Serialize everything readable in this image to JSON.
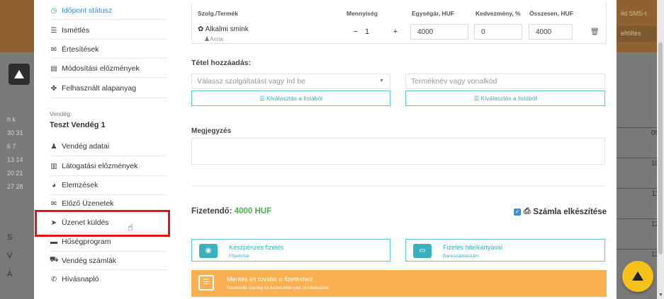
{
  "background": {
    "right_top_text": "ild SMS-t",
    "right_button": "eltöltés",
    "calendar_lines": [
      "h  k",
      "30  31",
      "6  7",
      "13  14",
      "20  21",
      "27  28"
    ],
    "lower_letters": [
      "S",
      "V",
      "Á"
    ],
    "times": [
      "09",
      "10",
      "11",
      "12",
      "13"
    ]
  },
  "sidebar": {
    "items_top": [
      {
        "icon": "clock-icon",
        "glyph": "◷",
        "label": "Időpont státusz",
        "active": true
      },
      {
        "icon": "list-icon",
        "glyph": "☰",
        "label": "Ismétlés"
      },
      {
        "icon": "chat-icon",
        "glyph": "✉",
        "label": "Értesítések"
      },
      {
        "icon": "file-icon",
        "glyph": "▤",
        "label": "Módosítási előzmények"
      },
      {
        "icon": "cubes-icon",
        "glyph": "✤",
        "label": "Felhasznált alapanyag"
      }
    ],
    "guest_label": "Vendég:",
    "guest_name": "Teszt Vendég 1",
    "items_bottom": [
      {
        "icon": "user-icon",
        "glyph": "♟",
        "label": "Vendég adatai"
      },
      {
        "icon": "history-icon",
        "glyph": "▥",
        "label": "Látogatási előzmények"
      },
      {
        "icon": "pie-icon",
        "glyph": "◕",
        "label": "Elemzések"
      },
      {
        "icon": "envelope-icon",
        "glyph": "✉",
        "label": "Előző Üzenetek"
      },
      {
        "icon": "send-icon",
        "glyph": "➤",
        "label": "Üzenet küldés"
      },
      {
        "icon": "card-icon",
        "glyph": "▬",
        "label": "Hűségprogram"
      },
      {
        "icon": "car-icon",
        "glyph": "⛟",
        "label": "Vendég számlák"
      },
      {
        "icon": "phone-icon",
        "glyph": "✆",
        "label": "Hívásnapló"
      }
    ]
  },
  "product_table": {
    "headers": {
      "product": "Szolg./Termék",
      "quantity": "Mennyiség",
      "unit_price": "Egységár, HUF",
      "discount": "Kedvezmény, %",
      "total": "Összesen, HUF"
    },
    "row": {
      "name": "Alkalmi smink",
      "staff": "Anna",
      "qty_minus": "−",
      "qty": "1",
      "qty_plus": "+",
      "unit_price": "4000",
      "discount": "0",
      "total": "4000"
    }
  },
  "add_item": {
    "title": "Tétel hozzáadás:",
    "service_placeholder": "Válassz szolgáltatást vagy írd be",
    "product_placeholder": "Terméknév vagy vonalkód",
    "list_button": "Kiválasztás a listából"
  },
  "note": {
    "title": "Megjegyzés"
  },
  "payment": {
    "label": "Fizetendő:",
    "amount": "4000 HUF",
    "invoice_label": "Számla elkészítése",
    "cash_title": "Készpénzes fizetés",
    "cash_sub": "Főpénztár",
    "card_title": "Fizetés hitelkártyával",
    "card_sub": "Bankszámlaszám",
    "save_title": "Mentés és tovább a fizetéshez",
    "save_sub": "Fizetendő összeg és kedvezmények részletezése"
  },
  "colors": {
    "accent_blue": "#3f8ed6",
    "teal": "#3bb1bd",
    "green": "#4caf50",
    "orange": "#f8b052",
    "highlight": "#e0161b"
  }
}
